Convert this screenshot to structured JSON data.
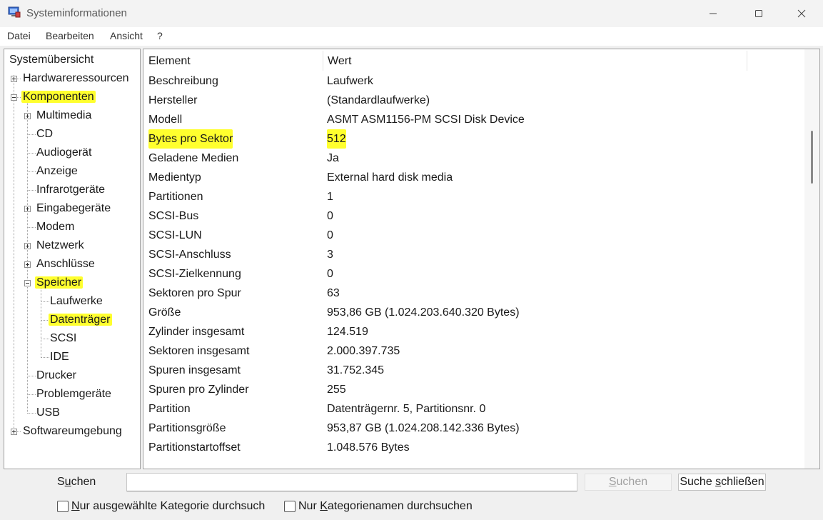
{
  "window": {
    "title": "Systeminformationen"
  },
  "menu": {
    "items": [
      "Datei",
      "Bearbeiten",
      "Ansicht",
      "?"
    ]
  },
  "tree": {
    "root": "Systemübersicht",
    "hardware": "Hardwareressourcen",
    "components": "Komponenten",
    "multimedia": "Multimedia",
    "cd": "CD",
    "audio": "Audiogerät",
    "display": "Anzeige",
    "infrared": "Infrarotgeräte",
    "input": "Eingabegeräte",
    "modem": "Modem",
    "network": "Netzwerk",
    "ports": "Anschlüsse",
    "storage": "Speicher",
    "drives": "Laufwerke",
    "disks": "Datenträger",
    "scsi": "SCSI",
    "ide": "IDE",
    "printer": "Drucker",
    "problem": "Problemgeräte",
    "usb": "USB",
    "software": "Softwareumgebung"
  },
  "table": {
    "headers": [
      "Element",
      "Wert"
    ],
    "rows": [
      {
        "k": "Beschreibung",
        "v": "Laufwerk"
      },
      {
        "k": "Hersteller",
        "v": "(Standardlaufwerke)"
      },
      {
        "k": "Modell",
        "v": "ASMT ASM1156-PM SCSI Disk Device"
      },
      {
        "k": "Bytes pro Sektor",
        "v": "512"
      },
      {
        "k": "Geladene Medien",
        "v": "Ja"
      },
      {
        "k": "Medientyp",
        "v": "External hard disk media"
      },
      {
        "k": "Partitionen",
        "v": "1"
      },
      {
        "k": "SCSI-Bus",
        "v": "0"
      },
      {
        "k": "SCSI-LUN",
        "v": "0"
      },
      {
        "k": "SCSI-Anschluss",
        "v": "3"
      },
      {
        "k": "SCSI-Zielkennung",
        "v": "0"
      },
      {
        "k": "Sektoren pro Spur",
        "v": "63"
      },
      {
        "k": "Größe",
        "v": "953,86 GB (1.024.203.640.320 Bytes)"
      },
      {
        "k": "Zylinder insgesamt",
        "v": "124.519"
      },
      {
        "k": "Sektoren insgesamt",
        "v": "2.000.397.735"
      },
      {
        "k": "Spuren insgesamt",
        "v": "31.752.345"
      },
      {
        "k": "Spuren pro Zylinder",
        "v": "255"
      },
      {
        "k": "Partition",
        "v": "Datenträgernr. 5, Partitionsnr. 0"
      },
      {
        "k": "Partitionsgröße",
        "v": "953,87 GB (1.024.208.142.336 Bytes)"
      },
      {
        "k": "Partitionstartoffset",
        "v": "1.048.576 Bytes"
      }
    ]
  },
  "search": {
    "label_pre": "S",
    "label_ul": "u",
    "label_post": "chen",
    "value": "",
    "search_btn_ul": "S",
    "search_btn_post": "uchen",
    "close_btn_pre": "Suche ",
    "close_btn_ul": "s",
    "close_btn_post": "chließen",
    "cb1_pre": "",
    "cb1_ul": "N",
    "cb1_post": "ur ausgewählte Kategorie durchsuch",
    "cb2_pre": "Nur ",
    "cb2_ul": "K",
    "cb2_post": "ategorienamen durchsuchen"
  },
  "colors": {
    "highlight": "#ffff2e"
  }
}
